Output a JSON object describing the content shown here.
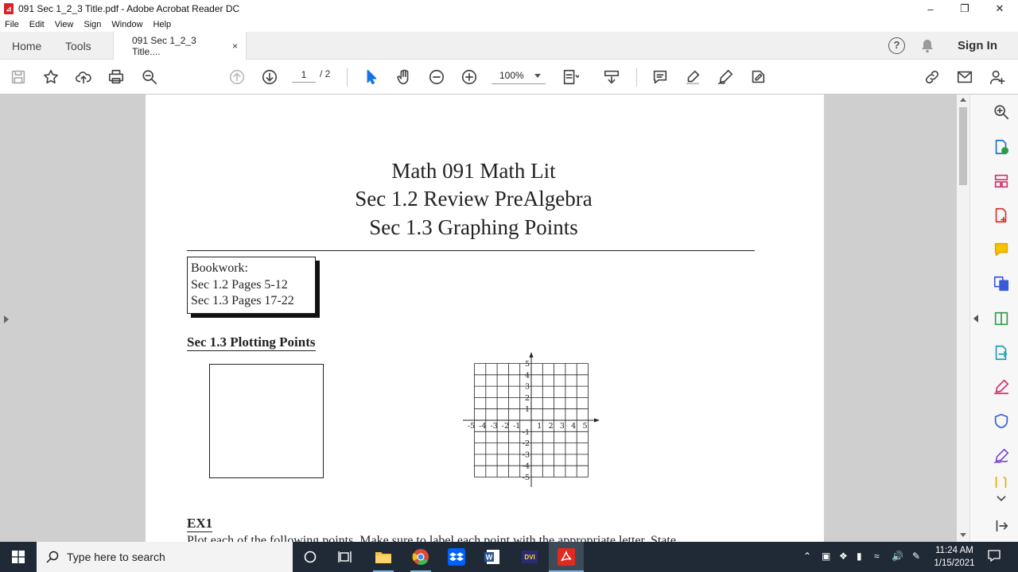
{
  "window": {
    "title": "091 Sec 1_2_3 Title.pdf - Adobe Acrobat Reader DC",
    "app_icon": "acrobat-icon",
    "controls": [
      "minimize-icon",
      "restore-icon",
      "close-icon"
    ]
  },
  "menu": {
    "items": [
      "File",
      "Edit",
      "View",
      "Sign",
      "Window",
      "Help"
    ]
  },
  "tabs": {
    "home": "Home",
    "tools": "Tools",
    "document": "091 Sec 1_2_3 Title....",
    "close_glyph": "×",
    "sign_in": "Sign In"
  },
  "toolbar": {
    "page_current": "1",
    "page_total": "/ 2",
    "zoom": "100%"
  },
  "document": {
    "title_lines": [
      "Math 091 Math Lit",
      "Sec 1.2 Review PreAlgebra",
      "Sec 1.3 Graphing Points"
    ],
    "bookwork_lines": [
      "Bookwork:",
      "Sec 1.2 Pages 5-12",
      "Sec 1.3 Pages 17-22"
    ],
    "section_heading": "Sec 1.3 Plotting Points",
    "grid_x_labels": [
      "-5",
      "-4",
      "-3",
      "-2",
      "-1",
      "1",
      "2",
      "3",
      "4",
      "5"
    ],
    "grid_y_labels": [
      "5",
      "4",
      "3",
      "2",
      "1",
      "-1",
      "-2",
      "-3",
      "-4",
      "-5"
    ],
    "ex1_heading": "EX1",
    "ex1_text": "Plot each of the following points. Make sure to label each point with the appropriate letter. State"
  },
  "taskbar": {
    "search_placeholder": "Type here to search",
    "time": "11:24 AM",
    "date": "1/15/2021"
  }
}
